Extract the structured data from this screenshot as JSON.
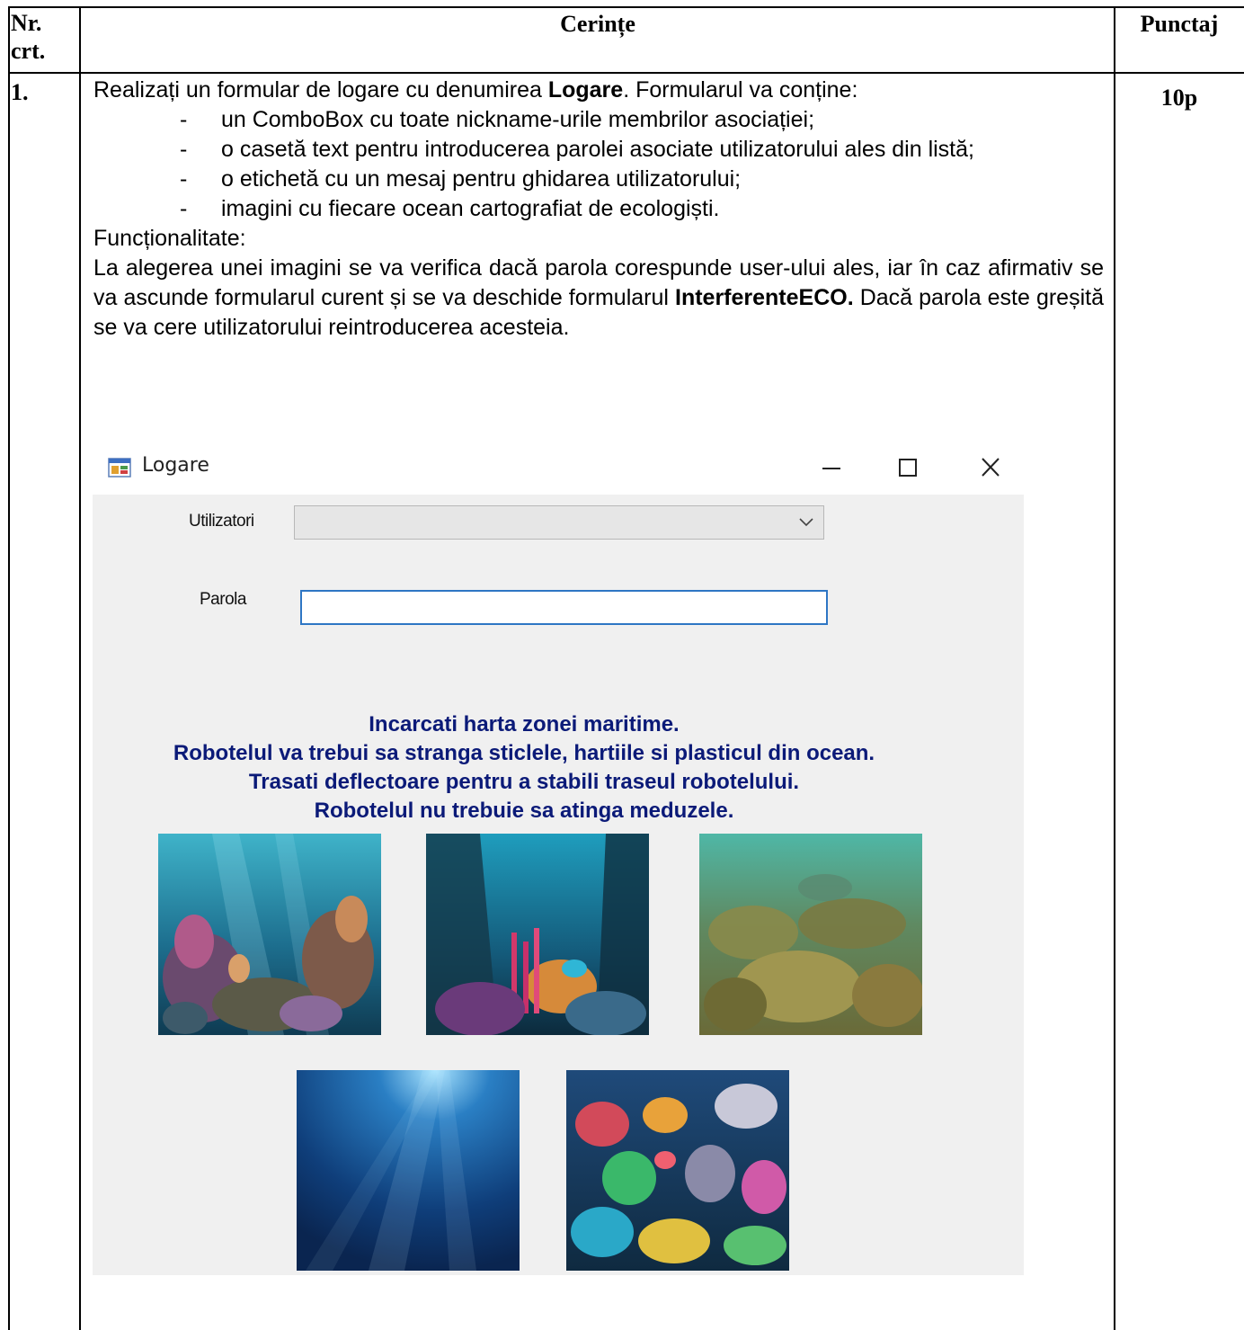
{
  "table": {
    "headers": {
      "nr": "Nr. crt.",
      "cerinte": "Cerințe",
      "punctaj": "Punctaj"
    },
    "row1": {
      "nr": "1.",
      "punctaj": "10p"
    }
  },
  "requirement": {
    "intro_before": "Realizați un formular de logare cu denumirea ",
    "form_name": "Logare",
    "intro_after": ". Formularul va conține:",
    "items": [
      "un ComboBox cu toate nickname-urile membrilor asociației;",
      "o casetă text pentru introducerea parolei asociate utilizatorului ales din listă;",
      "o etichetă cu un mesaj pentru ghidarea utilizatorului;",
      "imagini cu fiecare ocean cartografiat de ecologiști."
    ],
    "func_title": "Funcționalitate:",
    "func_before": "La alegerea unei imagini se va verifica dacă parola corespunde user-ului ales, iar în caz afirmativ se va ascunde formularul curent și se va deschide formularul ",
    "func_form": "InterferenteECO.",
    "func_after": " Dacă parola este greșită se va cere utilizatorului reintroducerea acesteia."
  },
  "form": {
    "title": "Logare",
    "icons": {
      "app": "form-app-icon",
      "minimize": "minimize-icon",
      "maximize": "maximize-icon",
      "close": "close-icon",
      "dropdown": "chevron-down-icon"
    },
    "users_label": "Utilizatori",
    "users_value": "",
    "password_label": "Parola",
    "password_value": "",
    "message": [
      "Incarcati harta zonei maritime.",
      "Robotelul va trebui sa stranga sticlele, hartiile si plasticul din ocean.",
      "Trasati deflectoare pentru a stabili traseul robotelului.",
      "Robotelul nu trebuie sa atinga meduzele."
    ],
    "colors": {
      "message": "#0b1a78",
      "client_bg": "#f0f0f0",
      "focus_border": "#2e76c4"
    }
  }
}
